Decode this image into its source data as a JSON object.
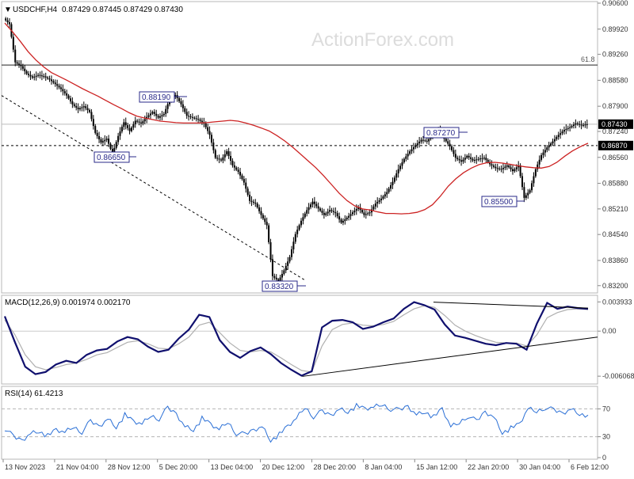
{
  "chart_data": [
    {
      "type": "candlestick",
      "symbol_header": "USDCHF,H4",
      "ohlc_header": "0.87429 0.87445 0.87429 0.87430",
      "watermark": "ActionForex.com",
      "ylim": [
        0.8305,
        0.906
      ],
      "yticks": [
        "0.90600",
        "0.89920",
        "0.89260",
        "0.88580",
        "0.87900",
        "0.87240",
        "0.86560",
        "0.85880",
        "0.85210",
        "0.84540",
        "0.83860",
        "0.83200"
      ],
      "current_price_label": "0.87430",
      "current_price": 0.8743,
      "horizontal_lines": [
        {
          "value": 0.8898,
          "label": "61.8",
          "style": "solid"
        },
        {
          "value": 0.8743,
          "label": "",
          "style": "solid"
        },
        {
          "value": 0.8687,
          "label": "0.86870",
          "style": "dashed"
        }
      ],
      "trendline": {
        "from": {
          "x": "13 Nov 2023",
          "y": 0.8818
        },
        "to": {
          "x": "28 Dec 20:00",
          "y": 0.8335
        },
        "style": "dashed"
      },
      "annotations": [
        {
          "label": "0.88190",
          "value": 0.8819
        },
        {
          "label": "0.86650",
          "value": 0.8665
        },
        {
          "label": "0.83320",
          "value": 0.8332
        },
        {
          "label": "0.87270",
          "value": 0.8727
        },
        {
          "label": "0.85500",
          "value": 0.855
        }
      ],
      "price_path": [
        0.902,
        0.9005,
        0.8905,
        0.8895,
        0.8875,
        0.8865,
        0.8872,
        0.8868,
        0.886,
        0.8848,
        0.8835,
        0.8818,
        0.8795,
        0.8782,
        0.879,
        0.8775,
        0.872,
        0.8695,
        0.8705,
        0.8665,
        0.8712,
        0.8748,
        0.8725,
        0.8752,
        0.8745,
        0.8762,
        0.8775,
        0.876,
        0.877,
        0.8808,
        0.8819,
        0.8795,
        0.8765,
        0.876,
        0.8755,
        0.8745,
        0.8715,
        0.8655,
        0.8648,
        0.8672,
        0.8635,
        0.8618,
        0.859,
        0.8542,
        0.8535,
        0.8505,
        0.8478,
        0.8345,
        0.8332,
        0.836,
        0.8395,
        0.8455,
        0.849,
        0.8518,
        0.854,
        0.8522,
        0.8505,
        0.8518,
        0.851,
        0.8485,
        0.8498,
        0.8512,
        0.8525,
        0.8505,
        0.8512,
        0.8535,
        0.8548,
        0.8565,
        0.8592,
        0.8625,
        0.8652,
        0.8672,
        0.8688,
        0.8702,
        0.8698,
        0.8717,
        0.8727,
        0.8705,
        0.8685,
        0.8655,
        0.8645,
        0.866,
        0.8648,
        0.8652,
        0.8655,
        0.8638,
        0.8628,
        0.8625,
        0.8635,
        0.862,
        0.8635,
        0.855,
        0.857,
        0.8625,
        0.8662,
        0.8682,
        0.8698,
        0.8715,
        0.8728,
        0.8735,
        0.8745,
        0.874,
        0.8743
      ],
      "moving_average": [
        0.9008,
        0.8985,
        0.896,
        0.8933,
        0.8911,
        0.8893,
        0.8878,
        0.8868,
        0.8858,
        0.8847,
        0.8836,
        0.8826,
        0.8816,
        0.8805,
        0.8794,
        0.8784,
        0.8773,
        0.8764,
        0.8759,
        0.8755,
        0.8751,
        0.8749,
        0.8747,
        0.8746,
        0.8746,
        0.8746,
        0.8747,
        0.8749,
        0.8751,
        0.8753,
        0.8751,
        0.8746,
        0.874,
        0.8733,
        0.8725,
        0.8713,
        0.8699,
        0.8683,
        0.8665,
        0.8647,
        0.8629,
        0.8608,
        0.8585,
        0.8562,
        0.8543,
        0.8529,
        0.8521,
        0.8518,
        0.8513,
        0.8509,
        0.8509,
        0.8508,
        0.8509,
        0.8512,
        0.8519,
        0.8532,
        0.8554,
        0.858,
        0.86,
        0.8616,
        0.8628,
        0.8637,
        0.8642,
        0.8643,
        0.8641,
        0.8638,
        0.8634,
        0.8631,
        0.8629,
        0.8628,
        0.8632,
        0.8643,
        0.8659,
        0.8673,
        0.8684,
        0.8693
      ],
      "series": [
        {
          "name": "MA",
          "color": "#cc2222"
        }
      ]
    },
    {
      "type": "line",
      "title": "MACD(12,26,9) 0.001974 0.002170",
      "ylim": [
        -0.0068,
        0.0045
      ],
      "yticks": [
        "0.003933",
        "0.00",
        "-0.006068"
      ],
      "series": [
        {
          "name": "MACD",
          "color": "#10106e",
          "values": [
            0.002,
            -0.0015,
            -0.0048,
            -0.0058,
            -0.0055,
            -0.0045,
            -0.004,
            -0.0043,
            -0.0032,
            -0.0026,
            -0.0024,
            -0.0014,
            -0.0008,
            -0.0011,
            -0.0021,
            -0.0028,
            -0.0025,
            -0.001,
            0.0002,
            0.0022,
            0.0019,
            -0.0012,
            -0.0028,
            -0.0036,
            -0.0027,
            -0.0022,
            -0.0031,
            -0.0043,
            -0.0052,
            -0.006,
            -0.0054,
            0.0005,
            0.0014,
            0.0015,
            0.0012,
            0.0003,
            0.0006,
            0.0012,
            0.0017,
            0.003,
            0.0039,
            0.0035,
            0.0029,
            0.0009,
            -0.0006,
            -0.0009,
            -0.0013,
            -0.0017,
            -0.0019,
            -0.0016,
            -0.0017,
            -0.0025,
            0.001,
            0.0038,
            0.003,
            0.0033,
            0.0031,
            0.003
          ]
        },
        {
          "name": "Signal",
          "color": "#b0b0b0",
          "values": [
            0.0015,
            -0.0005,
            -0.0032,
            -0.0048,
            -0.0052,
            -0.0049,
            -0.0045,
            -0.0043,
            -0.0038,
            -0.0032,
            -0.0029,
            -0.0022,
            -0.0015,
            -0.0013,
            -0.0017,
            -0.0023,
            -0.0024,
            -0.0017,
            -0.0008,
            0.0008,
            0.0012,
            -0.0002,
            -0.0016,
            -0.0026,
            -0.0028,
            -0.0026,
            -0.0028,
            -0.0036,
            -0.0045,
            -0.0053,
            -0.0055,
            -0.002,
            0.0002,
            0.0009,
            0.0011,
            0.0008,
            0.0007,
            0.0009,
            0.0013,
            0.0022,
            0.003,
            0.0034,
            0.0032,
            0.0021,
            0.0008,
            0.0,
            -0.0006,
            -0.0011,
            -0.0015,
            -0.0016,
            -0.0016,
            -0.002,
            -0.0005,
            0.0018,
            0.0025,
            0.0029,
            0.003,
            0.0029
          ]
        }
      ],
      "trendlines": [
        {
          "from": {
            "x": "28 Dec 20:00",
            "y": -0.0061
          },
          "to": {
            "x": "8 Feb",
            "y": -0.0008
          }
        },
        {
          "from": {
            "x": "15 Jan 12:00",
            "y": 0.0039
          },
          "to": {
            "x": "8 Feb",
            "y": 0.0031
          }
        }
      ]
    },
    {
      "type": "line",
      "title": "RSI(14) 61.4213",
      "ylim": [
        0,
        100
      ],
      "yticks": [
        "70",
        "30",
        "0"
      ],
      "levels": [
        70,
        30
      ],
      "series": [
        {
          "name": "RSI",
          "color": "#2a6fd6",
          "values": [
            42,
            30,
            25,
            35,
            38,
            31,
            40,
            36,
            44,
            37,
            52,
            45,
            56,
            44,
            61,
            52,
            48,
            60,
            56,
            71,
            63,
            45,
            40,
            56,
            48,
            40,
            51,
            35,
            33,
            40,
            45,
            25,
            33,
            45,
            56,
            72,
            59,
            66,
            61,
            70,
            66,
            74,
            70,
            72,
            76,
            70,
            68,
            74,
            62,
            66,
            58,
            70,
            44,
            50,
            60,
            52,
            66,
            59,
            36,
            42,
            48,
            70,
            66,
            72,
            68,
            64,
            70,
            63,
            61
          ]
        }
      ]
    },
    {
      "type": "axis",
      "xticks": [
        "13 Nov 2023",
        "21 Nov 04:00",
        "28 Nov 12:00",
        "5 Dec 20:00",
        "13 Dec 04:00",
        "20 Dec 12:00",
        "28 Dec 20:00",
        "8 Jan 04:00",
        "15 Jan 12:00",
        "22 Jan 20:00",
        "30 Jan 04:00",
        "6 Feb 12:00"
      ]
    }
  ]
}
